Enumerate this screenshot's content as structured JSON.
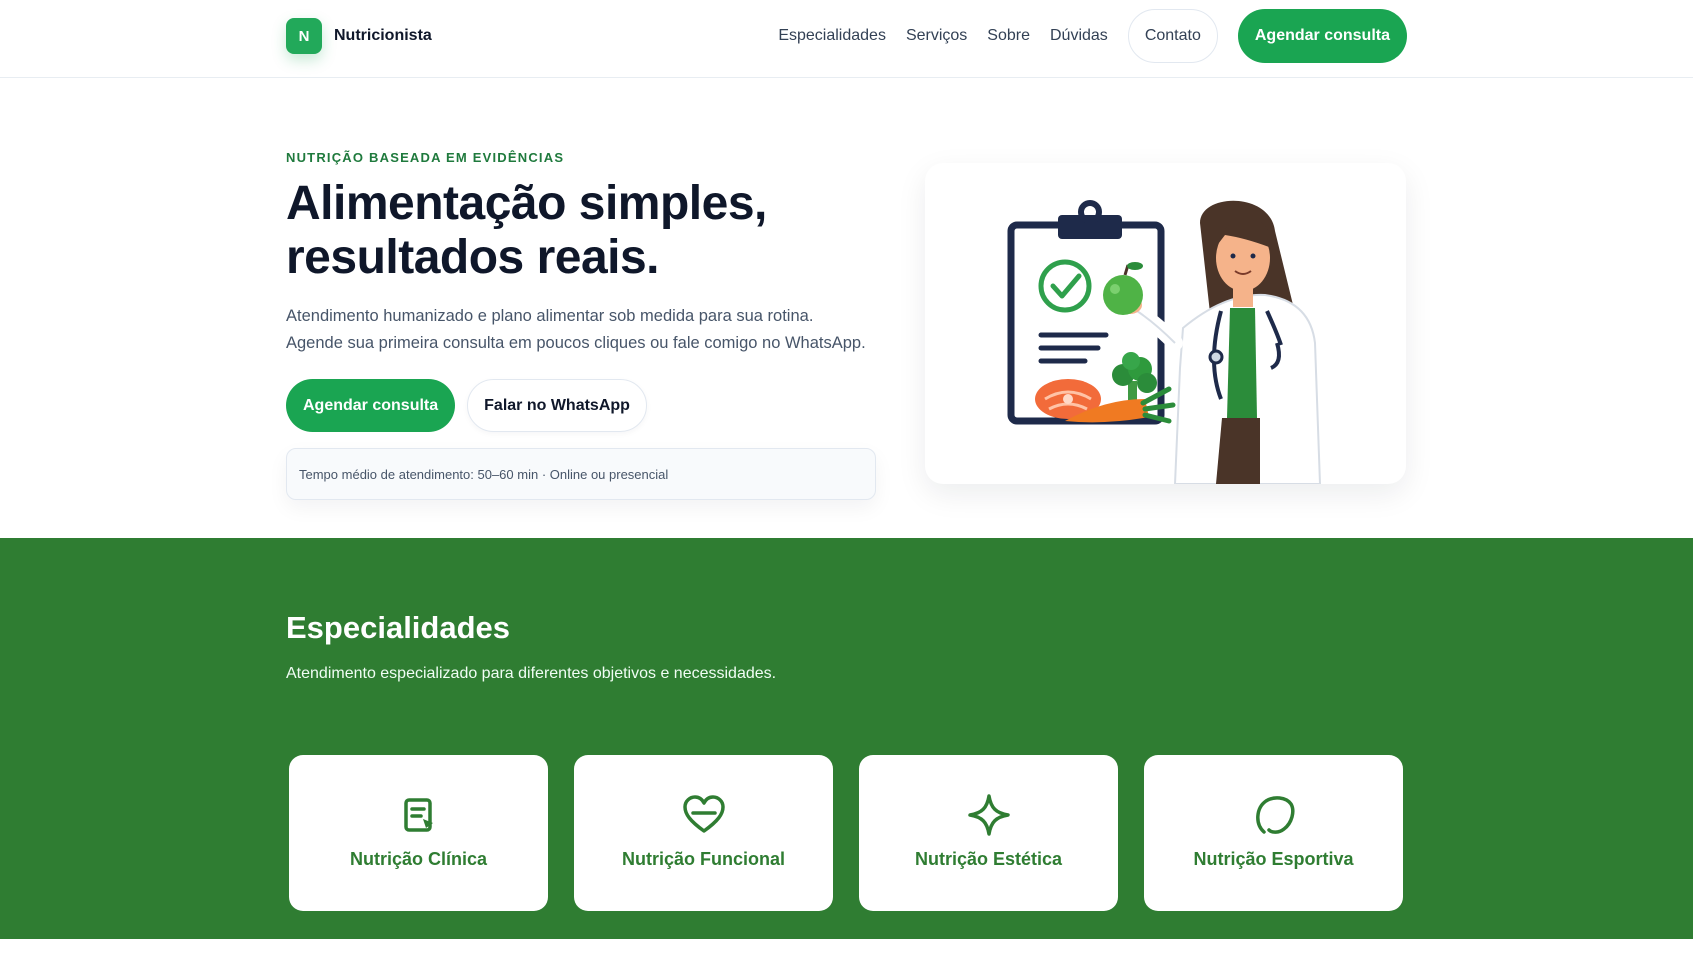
{
  "brand": {
    "logo_letter": "N",
    "name": "Nutricionista"
  },
  "nav": {
    "links": [
      "Especialidades",
      "Serviços",
      "Sobre",
      "Dúvidas"
    ],
    "contact": "Contato",
    "cta": "Agendar consulta"
  },
  "hero": {
    "eyebrow": "NUTRIÇÃO BASEADA EM EVIDÊNCIAS",
    "title_line1": "Alimentação simples,",
    "title_line2": "resultados reais.",
    "subtitle_line1": "Atendimento humanizado e plano alimentar sob medida para sua rotina.",
    "subtitle_line2": "Agende sua primeira consulta em poucos cliques ou fale comigo no WhatsApp.",
    "primary_button": "Agendar consulta",
    "secondary_button": "Falar no WhatsApp",
    "info": "Tempo médio de atendimento: 50–60 min · Online ou presencial"
  },
  "specialties": {
    "title": "Especialidades",
    "subtitle": "Atendimento especializado para diferentes objetivos e necessidades.",
    "items": [
      {
        "label": "Nutrição Clínica",
        "icon": "clipboard-icon"
      },
      {
        "label": "Nutrição Funcional",
        "icon": "heart-icon"
      },
      {
        "label": "Nutrição Estética",
        "icon": "sparkle-icon"
      },
      {
        "label": "Nutrição Esportiva",
        "icon": "leaf-icon"
      }
    ]
  },
  "colors": {
    "primary": "#1aa552",
    "section_green": "#2f7d32",
    "eyebrow": "#1f7a3d"
  }
}
